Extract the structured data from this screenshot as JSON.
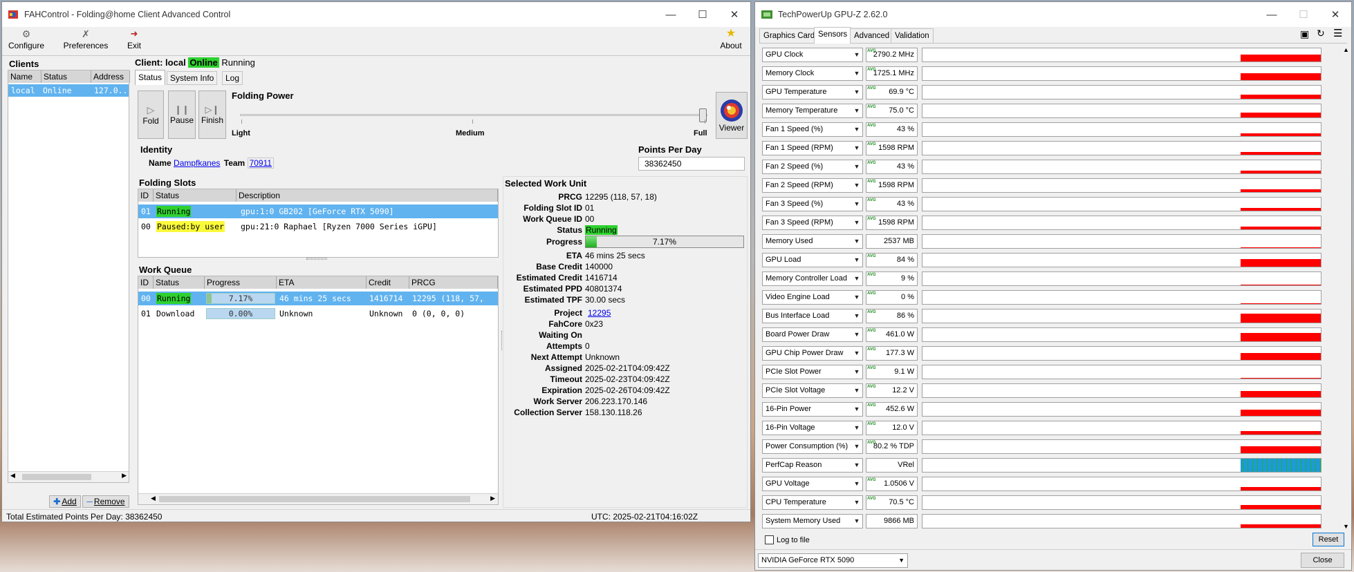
{
  "fah": {
    "title": "FAHControl - Folding@home Client Advanced Control",
    "toolbar": {
      "configure": "Configure",
      "preferences": "Preferences",
      "exit": "Exit",
      "about": "About"
    },
    "clients": {
      "heading": "Clients",
      "cols": [
        "Name",
        "Status",
        "Address"
      ],
      "row": {
        "name": "local",
        "status": "Online",
        "address": "127.0..."
      },
      "add": "Add",
      "remove": "Remove"
    },
    "client_header": {
      "prefix": "Client: local",
      "status": "Online",
      "state": "Running"
    },
    "tabs": [
      "Status",
      "System Info",
      "Log"
    ],
    "controls": {
      "fold": "Fold",
      "pause": "Pause",
      "finish": "Finish",
      "viewer": "Viewer"
    },
    "folding_power": {
      "heading": "Folding Power",
      "light": "Light",
      "medium": "Medium",
      "full": "Full",
      "level": 1.0
    },
    "identity": {
      "heading": "Identity",
      "name_label": "Name",
      "name": "Dampfkanes",
      "team_label": "Team",
      "team": "70911"
    },
    "ppd": {
      "heading": "Points Per Day",
      "value": "38362450"
    },
    "slots": {
      "heading": "Folding Slots",
      "cols": [
        "ID",
        "Status",
        "Description"
      ],
      "rows": [
        {
          "id": "01",
          "status": "Running",
          "desc": "gpu:1:0 GB202 [GeForce RTX 5090]"
        },
        {
          "id": "00",
          "status": "Paused:by user",
          "desc": "gpu:21:0 Raphael [Ryzen 7000 Series iGPU]"
        }
      ]
    },
    "queue": {
      "heading": "Work Queue",
      "cols": [
        "ID",
        "Status",
        "Progress",
        "ETA",
        "Credit",
        "PRCG"
      ],
      "rows": [
        {
          "id": "00",
          "status": "Running",
          "progress": "7.17%",
          "progress_value": 0.0717,
          "eta": "46 mins 25 secs",
          "credit": "1416714",
          "prcg": "12295 (118, 57,"
        },
        {
          "id": "01",
          "status": "Download",
          "progress": "0.00%",
          "progress_value": 0,
          "eta": "Unknown",
          "credit": "Unknown",
          "prcg": "0 (0, 0, 0)"
        }
      ]
    },
    "wu": {
      "heading": "Selected Work Unit",
      "fields": [
        {
          "label": "PRCG",
          "value": "12295 (118, 57, 18)"
        },
        {
          "label": "Folding Slot ID",
          "value": "01"
        },
        {
          "label": "Work Queue ID",
          "value": "00"
        },
        {
          "label": "Status",
          "value": "Running"
        },
        {
          "label": "Progress",
          "value": "7.17%"
        },
        {
          "label": "ETA",
          "value": "46 mins 25 secs"
        },
        {
          "label": "Base Credit",
          "value": "140000"
        },
        {
          "label": "Estimated Credit",
          "value": "1416714"
        },
        {
          "label": "Estimated PPD",
          "value": "40801374"
        },
        {
          "label": "Estimated TPF",
          "value": "30.00 secs"
        },
        {
          "label": "Project",
          "value": "12295"
        },
        {
          "label": "FahCore",
          "value": "0x23"
        },
        {
          "label": "Waiting On",
          "value": ""
        },
        {
          "label": "Attempts",
          "value": "0"
        },
        {
          "label": "Next Attempt",
          "value": "Unknown"
        },
        {
          "label": "Assigned",
          "value": "2025-02-21T04:09:42Z"
        },
        {
          "label": "Timeout",
          "value": "2025-02-23T04:09:42Z"
        },
        {
          "label": "Expiration",
          "value": "2025-02-26T04:09:42Z"
        },
        {
          "label": "Work Server",
          "value": "206.223.170.146"
        },
        {
          "label": "Collection Server",
          "value": "158.130.118.26"
        }
      ],
      "progress_value": 0.0717
    },
    "statusbar": {
      "left": "Total Estimated Points Per Day: 38362450",
      "right": "UTC: 2025-02-21T04:16:02Z"
    }
  },
  "gpuz": {
    "title": "TechPowerUp GPU-Z 2.62.0",
    "tabs": [
      "Graphics Card",
      "Sensors",
      "Advanced",
      "Validation"
    ],
    "avg": "AVG",
    "sensors": [
      {
        "name": "GPU Clock",
        "value": "2790.2 MHz",
        "avg": true,
        "level": 0.55
      },
      {
        "name": "Memory Clock",
        "value": "1725.1 MHz",
        "avg": true,
        "level": 0.55
      },
      {
        "name": "GPU Temperature",
        "value": "69.9 °C",
        "avg": true,
        "level": 0.3
      },
      {
        "name": "Memory Temperature",
        "value": "75.0 °C",
        "avg": true,
        "level": 0.35
      },
      {
        "name": "Fan 1 Speed (%)",
        "value": "43 %",
        "avg": true,
        "level": 0.22
      },
      {
        "name": "Fan 1 Speed (RPM)",
        "value": "1598 RPM",
        "avg": true,
        "level": 0.22
      },
      {
        "name": "Fan 2 Speed (%)",
        "value": "43 %",
        "avg": true,
        "level": 0.22
      },
      {
        "name": "Fan 2 Speed (RPM)",
        "value": "1598 RPM",
        "avg": true,
        "level": 0.22
      },
      {
        "name": "Fan 3 Speed (%)",
        "value": "43 %",
        "avg": true,
        "level": 0.22
      },
      {
        "name": "Fan 3 Speed (RPM)",
        "value": "1598 RPM",
        "avg": true,
        "level": 0.22
      },
      {
        "name": "Memory Used",
        "value": "2537 MB",
        "avg": false,
        "level": 0.07
      },
      {
        "name": "GPU Load",
        "value": "84 %",
        "avg": true,
        "level": 0.6
      },
      {
        "name": "Memory Controller Load",
        "value": "9 %",
        "avg": true,
        "level": 0.07
      },
      {
        "name": "Video Engine Load",
        "value": "0 %",
        "avg": true,
        "level": 0.0
      },
      {
        "name": "Bus Interface Load",
        "value": "86 %",
        "avg": true,
        "level": 0.7
      },
      {
        "name": "Board Power Draw",
        "value": "461.0 W",
        "avg": true,
        "level": 0.65
      },
      {
        "name": "GPU Chip Power Draw",
        "value": "177.3 W",
        "avg": true,
        "level": 0.55
      },
      {
        "name": "PCIe Slot Power",
        "value": "9.1 W",
        "avg": true,
        "level": 0.05
      },
      {
        "name": "PCIe Slot Voltage",
        "value": "12.2 V",
        "avg": true,
        "level": 0.5
      },
      {
        "name": "16-Pin Power",
        "value": "452.6 W",
        "avg": true,
        "level": 0.45
      },
      {
        "name": "16-Pin Voltage",
        "value": "12.0 V",
        "avg": true,
        "level": 0.25
      },
      {
        "name": "Power Consumption (%)",
        "value": "80.2 % TDP",
        "avg": true,
        "level": 0.55
      },
      {
        "name": "PerfCap Reason",
        "value": "VRel",
        "avg": false,
        "level": 1.0,
        "perfcap": true
      },
      {
        "name": "GPU Voltage",
        "value": "1.0506 V",
        "avg": true,
        "level": 0.25
      },
      {
        "name": "CPU Temperature",
        "value": "70.5 °C",
        "avg": true,
        "level": 0.3
      },
      {
        "name": "System Memory Used",
        "value": "9866 MB",
        "avg": false,
        "level": 0.25
      }
    ],
    "log_to_file": "Log to file",
    "reset": "Reset",
    "device": "NVIDIA GeForce RTX 5090",
    "close": "Close",
    "colors": {
      "graph": "#ff0000",
      "perfcap": "#1f9ad6"
    }
  }
}
